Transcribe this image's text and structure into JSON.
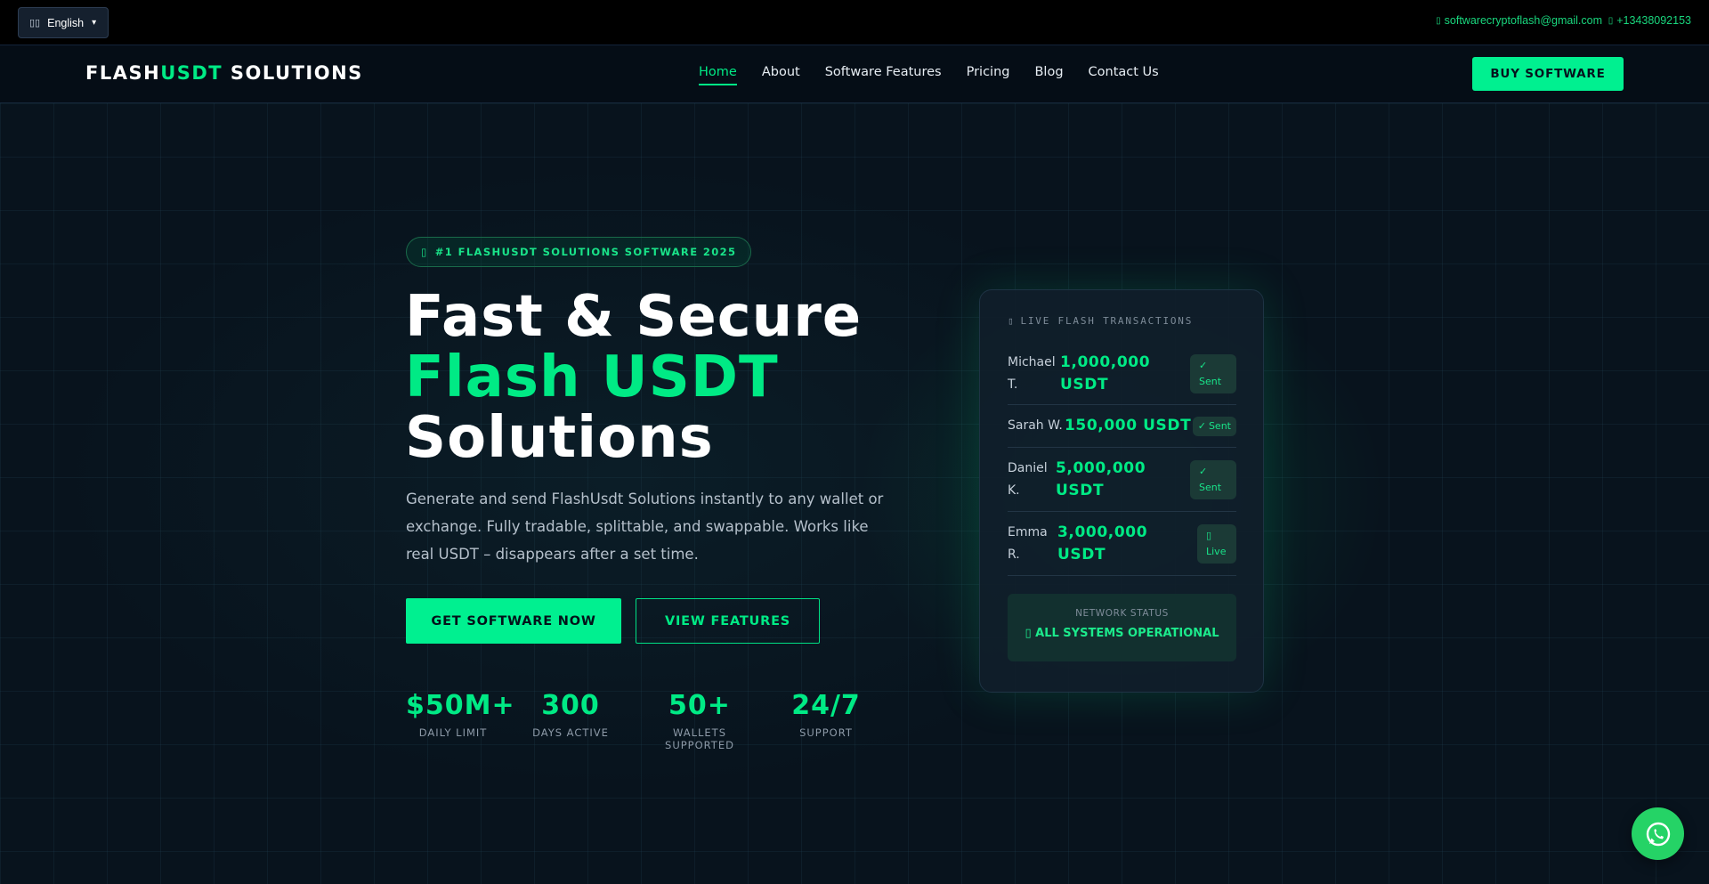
{
  "topbar": {
    "language": {
      "flag_icon": "flag-icon",
      "label": "English",
      "caret": "▾"
    },
    "email": {
      "icon": "email-icon",
      "text": "softwarecryptoflash@gmail.com"
    },
    "phone": {
      "icon": "phone-icon",
      "text": "+13438092153"
    }
  },
  "nav": {
    "logo": {
      "part1": "FLASH",
      "part2": "USDT",
      "part3": " SOLUTIONS"
    },
    "items": [
      {
        "label": "Home",
        "active": true
      },
      {
        "label": "About",
        "active": false
      },
      {
        "label": "Software Features",
        "active": false
      },
      {
        "label": "Pricing",
        "active": false
      },
      {
        "label": "Blog",
        "active": false
      },
      {
        "label": "Contact Us",
        "active": false
      }
    ],
    "buy_label": "BUY SOFTWARE"
  },
  "hero": {
    "badge": {
      "icon": "rocket-icon",
      "text": "#1 FLASHUSDT SOLUTIONS SOFTWARE 2025"
    },
    "headline": {
      "line1": "Fast & Secure",
      "line2": "Flash USDT",
      "line3": "Solutions"
    },
    "subtext": "Generate and send FlashUsdt Solutions instantly to any wallet or exchange. Fully tradable, splittable, and swappable. Works like real USDT – disappears after a set time.",
    "cta_primary": "GET SOFTWARE NOW",
    "cta_secondary": "VIEW FEATURES",
    "stats": [
      {
        "value": "$50M+",
        "label": "DAILY LIMIT"
      },
      {
        "value": "300",
        "label": "DAYS ACTIVE"
      },
      {
        "value": "50+",
        "label": "WALLETS SUPPORTED"
      },
      {
        "value": "24/7",
        "label": "SUPPORT"
      }
    ]
  },
  "live_card": {
    "title_icon": "bolt-icon",
    "title": "LIVE FLASH TRANSACTIONS",
    "transactions": [
      {
        "name": "Michael T.",
        "amount": "1,000,000 USDT",
        "status_icon": "✓",
        "status": "Sent"
      },
      {
        "name": "Sarah W.",
        "amount": "150,000 USDT",
        "status_icon": "✓",
        "status": "Sent"
      },
      {
        "name": "Daniel K.",
        "amount": "5,000,000 USDT",
        "status_icon": "✓",
        "status": "Sent"
      },
      {
        "name": "Emma R.",
        "amount": "3,000,000 USDT",
        "status_icon": "clock-icon",
        "status": "Live"
      }
    ],
    "network_label": "NETWORK STATUS",
    "network_status": "ALL SYSTEMS OPERATIONAL",
    "network_icon": "check-circle-icon"
  },
  "floating": {
    "whatsapp_icon": "whatsapp-icon"
  },
  "colors": {
    "accent": "#00ea85",
    "background": "#08131d",
    "topbar": "#000000",
    "whatsapp": "#25d366"
  }
}
